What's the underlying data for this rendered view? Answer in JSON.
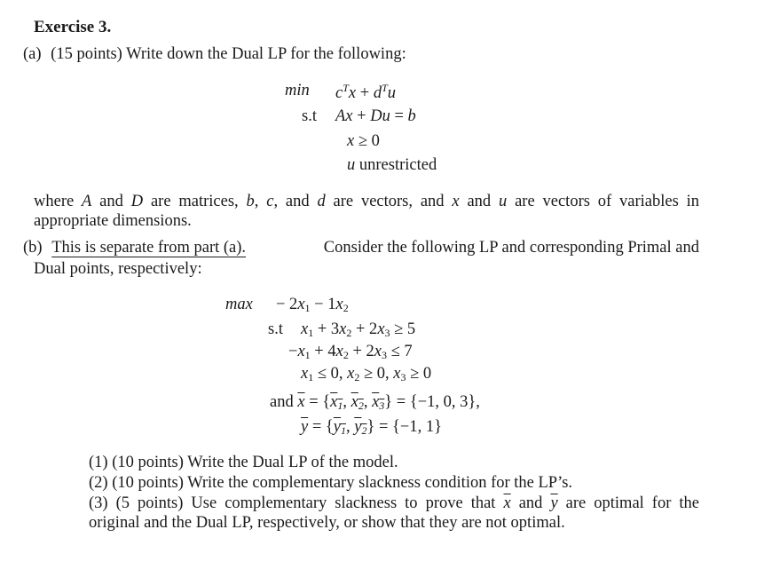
{
  "title": "Exercise 3.",
  "part_a": {
    "label": "(a)",
    "prompt": "(15 points) Write down the Dual LP for the following:",
    "lp": {
      "objective_kw": "min",
      "objective": "cᵀx + dᵀu",
      "st_kw": "s.t",
      "constraint": "Ax + Du = b",
      "sign_x": "x ≥ 0",
      "sign_u_var": "u",
      "sign_u_text": "unrestricted"
    },
    "description_line1": "where A and D are matrices, b, c, and d are vectors, and x and u are vectors of variables in",
    "description_line2": "appropriate dimensions."
  },
  "part_b": {
    "label": "(b)",
    "underlined": "This is separate from part (a).",
    "rest_line1": "Consider the following LP and corresponding Primal and",
    "line2": "Dual points, respectively:",
    "lp": {
      "objective_kw": "max",
      "objective": "− 2x₁ − 1x₂",
      "st_kw": "s.t",
      "constraint1": "x₁ + 3x₂ + 2x₃ ≥ 5",
      "constraint2": "−x₁ + 4x₂ + 2x₃ ≤ 7",
      "signs": "x₁ ≤ 0, x₂ ≥ 0, x₃ ≥ 0",
      "and_kw": "and",
      "xbar": "x̄ = {x̄₁, x̄₂, x̄₃} = {−1, 0, 3},",
      "ybar": "ȳ = {ȳ₁, ȳ₂} = {−1, 1}"
    },
    "questions": [
      "(1) (10 points) Write the Dual LP of the model.",
      "(2) (10 points) Write the complementary slackness condition for the LP’s.",
      "(3) (5 points) Use complementary slackness to prove that x̄ and ȳ are optimal for the",
      "original and the Dual LP, respectively, or show that they are not optimal."
    ]
  }
}
